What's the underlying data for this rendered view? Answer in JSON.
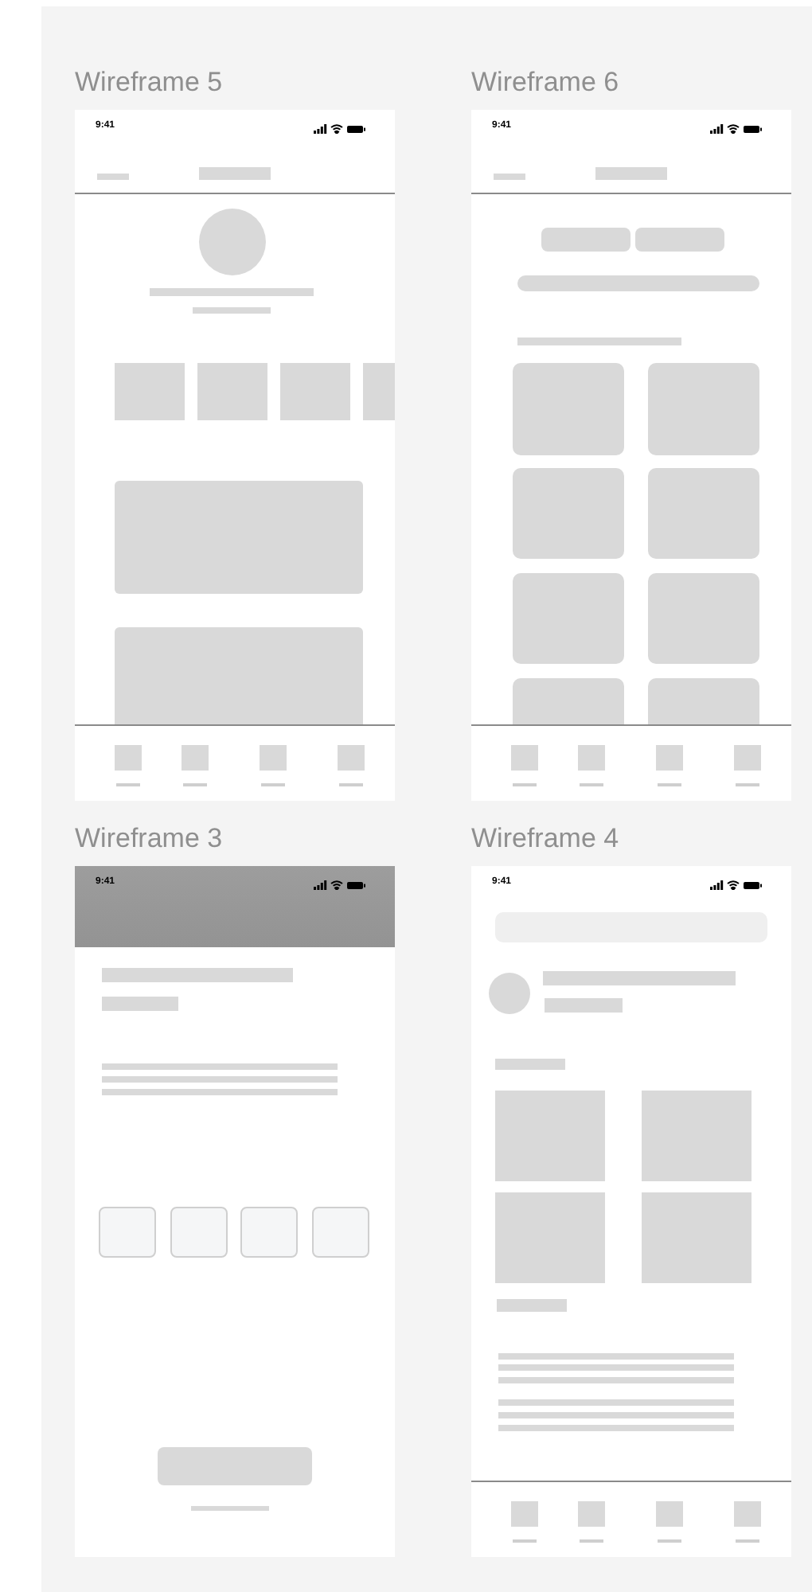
{
  "frames": [
    {
      "title": "Wireframe 5",
      "kind": "profile",
      "time": "9:41"
    },
    {
      "title": "Wireframe 6",
      "kind": "grid",
      "time": "9:41"
    },
    {
      "title": "Wireframe 3",
      "kind": "verify",
      "time": "9:41"
    },
    {
      "title": "Wireframe 4",
      "kind": "feed",
      "time": "9:41"
    }
  ]
}
